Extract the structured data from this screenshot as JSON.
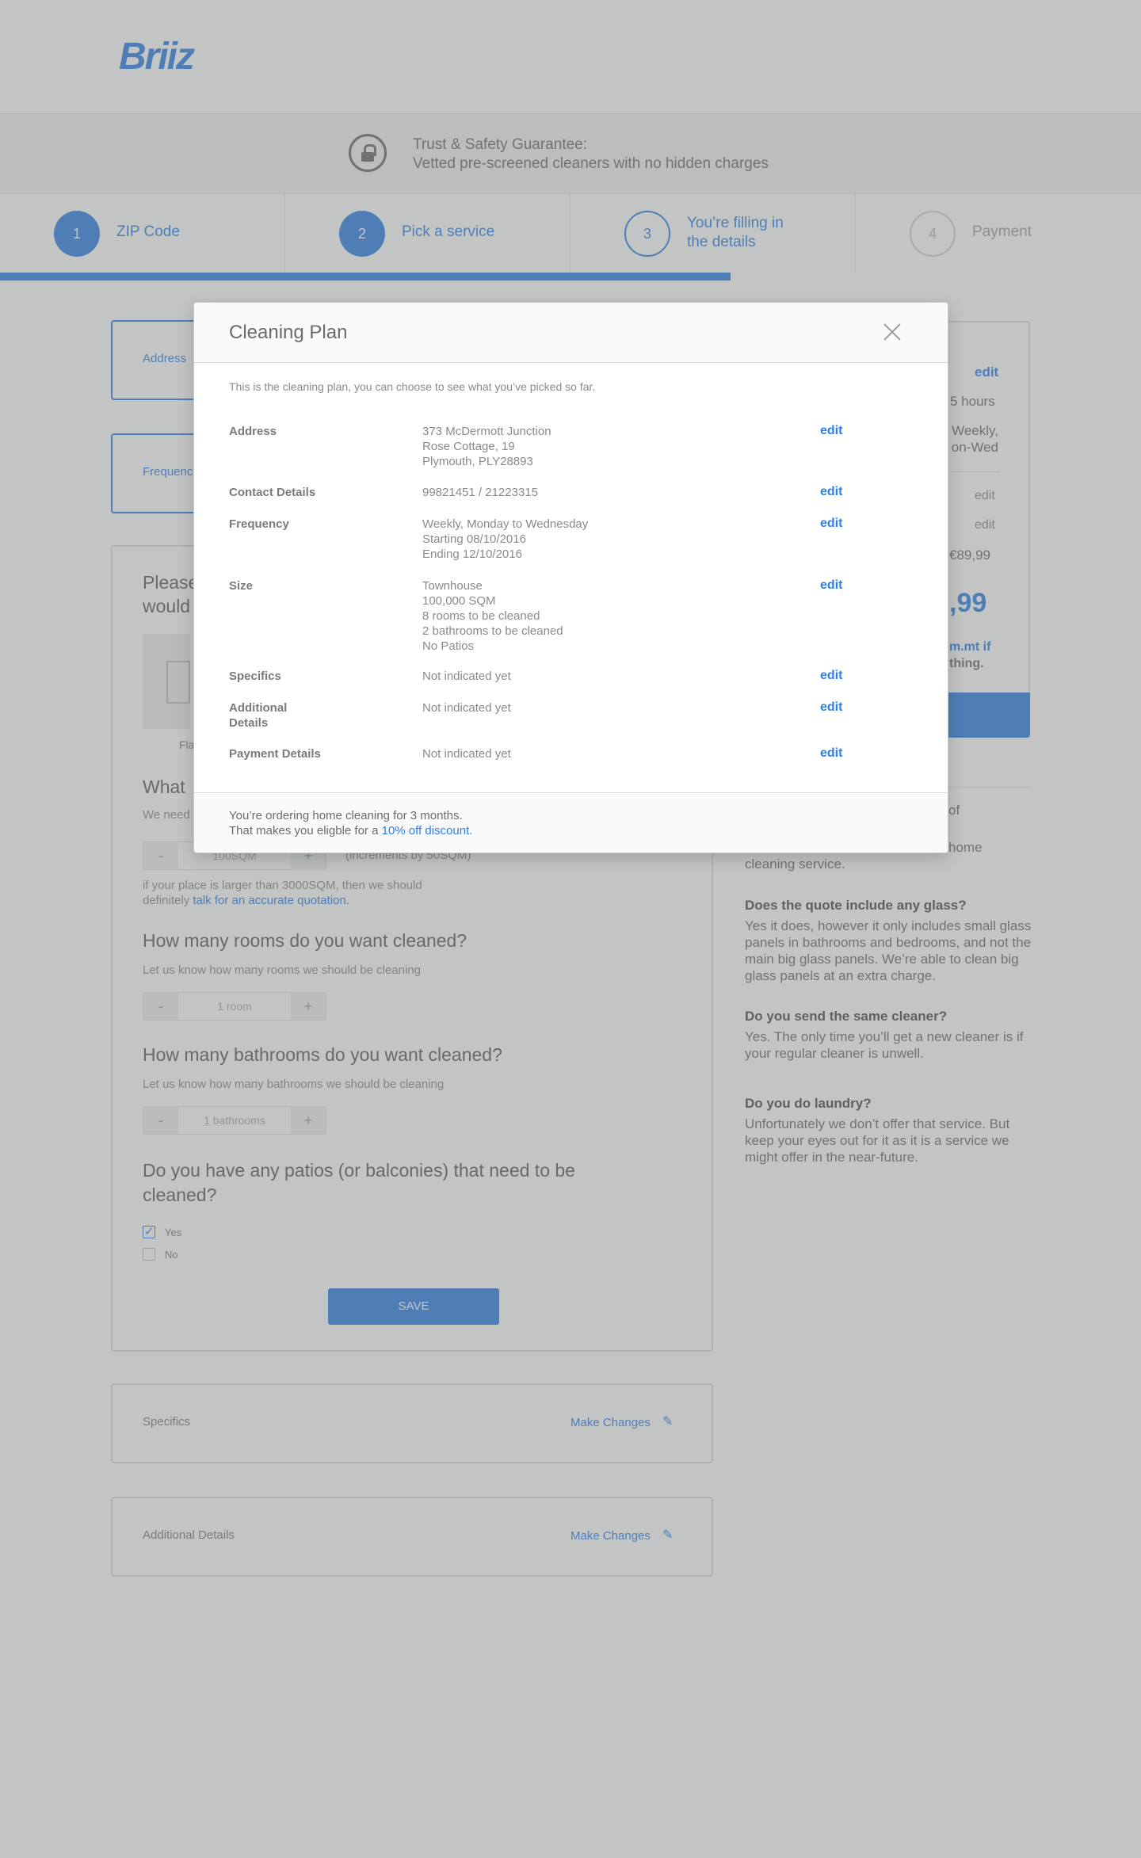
{
  "brand": {
    "logo": "Briiz",
    "accent": "#2e7fe8"
  },
  "trust": {
    "line1": "Trust & Safety Guarantee:",
    "line2": "Vetted pre-screened cleaners with no hidden charges"
  },
  "steps": [
    {
      "number": "1",
      "label": "ZIP Code",
      "state": "done"
    },
    {
      "number": "2",
      "label": "Pick a service",
      "state": "done"
    },
    {
      "number": "3",
      "label_line1": "You’re filling in",
      "label_line2": "the details",
      "state": "current"
    },
    {
      "number": "4",
      "label": "Payment",
      "state": "pending"
    }
  ],
  "progress": {
    "fraction": 0.64
  },
  "left": {
    "address_label": "Address",
    "frequency_label": "Frequenc",
    "size_title_l1": "Please",
    "size_title_l2": "would",
    "flat_label": "Fla",
    "what_title": "What",
    "what_sub": "We need",
    "sqm_value": "100SQM",
    "sqm_note": "(increments by 50SQM)",
    "large_note_l1": "if your place is larger than 3000SQM, then we should",
    "large_note_l2_prefix": "definitely ",
    "large_note_link": "talk for an accurate quotation.",
    "rooms_title": "How many rooms do you want cleaned?",
    "rooms_sub": "Let us know how many rooms we should be cleaning",
    "rooms_value": "1 room",
    "baths_title": "How many bathrooms do you want cleaned?",
    "baths_sub": "Let us know how many bathrooms we should be cleaning",
    "baths_value": "1 bathrooms",
    "patio_title_l1": "Do you have any patios (or balconies) that need to be",
    "patio_title_l2": "cleaned?",
    "yes": "Yes",
    "no": "No",
    "save": "SAVE",
    "minus": "-",
    "plus": "+",
    "specifics_label": "Specifics",
    "additional_label": "Additional Details",
    "make_changes": "Make Changes"
  },
  "side": {
    "edit": "edit",
    "hours": "5 hours",
    "freq_l1": "Weekly,",
    "freq_l2": "on-Wed",
    "price_small": "€89,99",
    "price_big": ",99",
    "contact_l1": "m.mt if",
    "contact_l2": "thing.",
    "faq_frag1": "of",
    "faq_frag2": "home",
    "faq_frag3": "cleaning service.",
    "faqs": [
      {
        "q": "Does the quote include any glass?",
        "a": "Yes it does, however it only includes small glass panels in bathrooms and bedrooms, and not the main big glass panels. We’re able to clean big glass panels at an extra charge."
      },
      {
        "q": "Do you send the same cleaner?",
        "a": "Yes. The only time you’ll get a new cleaner is if your regular cleaner is unwell."
      },
      {
        "q": "Do you do laundry?",
        "a": "Unfortunately we don’t offer that service. But keep your eyes out for it as it is a service we might offer in the near-future."
      }
    ]
  },
  "modal": {
    "title": "Cleaning Plan",
    "intro": "This is the cleaning plan, you can choose to see what you’ve picked so far.",
    "rows": [
      {
        "label": "Address",
        "value": "373 McDermott Junction\nRose Cottage, 19\nPlymouth, PLY28893",
        "edit": "edit"
      },
      {
        "label": "Contact Details",
        "value": "99821451 / 21223315",
        "edit": "edit"
      },
      {
        "label": "Frequency",
        "value": "Weekly, Monday to Wednesday\nStarting 08/10/2016\nEnding 12/10/2016",
        "edit": "edit"
      },
      {
        "label": "Size",
        "value": "Townhouse\n100,000 SQM\n8 rooms to be cleaned\n2 bathrooms to be cleaned\nNo Patios",
        "edit": "edit"
      },
      {
        "label": "Specifics",
        "value": "Not indicated yet",
        "edit": "edit"
      },
      {
        "label": "Additional\nDetails",
        "value": "Not indicated yet",
        "edit": "edit"
      },
      {
        "label": "Payment Details",
        "value": "Not indicated yet",
        "edit": "edit"
      }
    ],
    "footer_l1": "You’re ordering home cleaning for 3 months.",
    "footer_l2_prefix": "That makes you eligble for a ",
    "footer_link": "10% off discount",
    "footer_l2_suffix": "."
  }
}
